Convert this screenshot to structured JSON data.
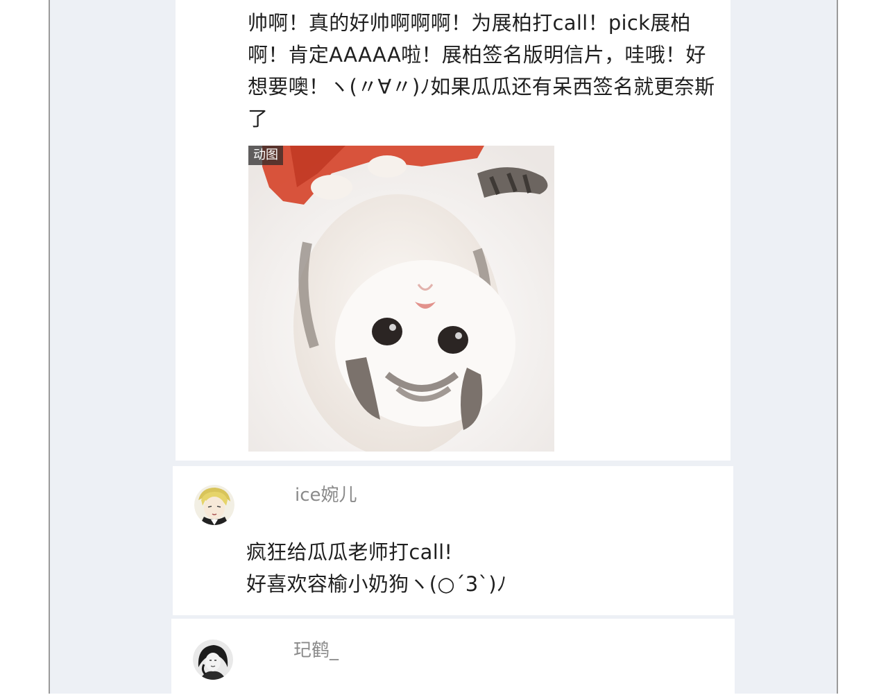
{
  "comments": [
    {
      "text": "帅啊！真的好帅啊啊啊！为展柏打call！pick展柏啊！肯定AAAAA啦！展柏签名版明信片，哇哦！好想要噢！ヽ(〃∀〃)ﾉ如果瓜瓜还有呆西签名就更奈斯了",
      "image": {
        "badge": "动图",
        "subject": "upside-down-kitten-gif"
      }
    },
    {
      "username": "ice婉儿",
      "text": "疯狂给瓜瓜老师打call!\n好喜欢容榆小奶狗ヽ(○´3`)ﾉ"
    },
    {
      "username": "玘鹤_"
    }
  ],
  "colors": {
    "background": "#edf0f5",
    "card": "#ffffff",
    "text": "#1f1f1f",
    "username": "#8a8a8a",
    "frame_border": "#9a9a9a"
  }
}
